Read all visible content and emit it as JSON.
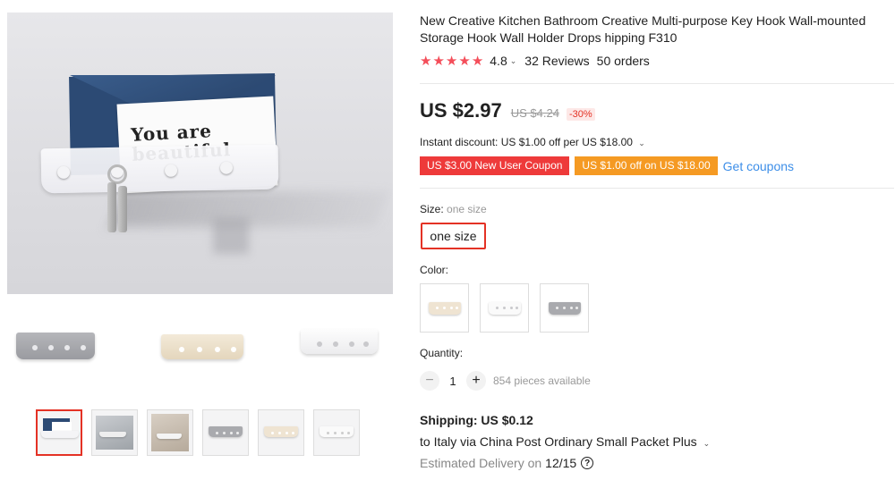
{
  "product": {
    "title": "New Creative Kitchen Bathroom Creative Multi-purpose Key Hook Wall-mounted Storage Hook Wall Holder Drops hipping F310",
    "rating": "4.8",
    "reviews": "32 Reviews",
    "orders": "50 orders"
  },
  "main_image": {
    "card_text_line1": "You are",
    "card_text_line2": "beautiful"
  },
  "price": {
    "current": "US $2.97",
    "original": "US $4.24",
    "discount": "-30%"
  },
  "promo": {
    "instant_discount": "Instant discount: US $1.00 off per US $18.00",
    "coupon_new_user": "US $3.00 New User Coupon",
    "coupon_off": "US $1.00 off on US $18.00",
    "get_coupons": "Get coupons"
  },
  "size": {
    "label": "Size:",
    "selected": "one size",
    "option": "one size"
  },
  "color": {
    "label": "Color:",
    "options": [
      {
        "name": "beige",
        "hex": "#efe4d2"
      },
      {
        "name": "white",
        "hex": "#f7f7f7"
      },
      {
        "name": "gray",
        "hex": "#a9aaae"
      }
    ]
  },
  "quantity": {
    "label": "Quantity:",
    "minus": "−",
    "value": "1",
    "plus": "+",
    "available": "854 pieces available"
  },
  "shipping": {
    "title": "Shipping: US $0.12",
    "destination": "to Italy via China Post Ordinary Small Packet Plus",
    "estimated_label": "Estimated Delivery on",
    "estimated_date": "12/15",
    "help_glyph": "?"
  },
  "gallery": {
    "variants": [
      {
        "name": "gray",
        "hex": "#a9aaae"
      },
      {
        "name": "beige",
        "hex": "#efe4d2"
      },
      {
        "name": "white",
        "hex": "#f7f7f7"
      }
    ],
    "thumbnails": [
      "main",
      "bathroom",
      "kitchen",
      "gray",
      "beige",
      "white"
    ]
  },
  "colors": {
    "accent_red": "#e43225",
    "coupon_red": "#ee3a3a",
    "coupon_orange": "#f59a23",
    "link_blue": "#3d8ee8",
    "star": "#f44e5a"
  },
  "icons": {
    "star": "star-icon",
    "caret": "chevron-down-icon",
    "help": "question-circle-icon"
  }
}
